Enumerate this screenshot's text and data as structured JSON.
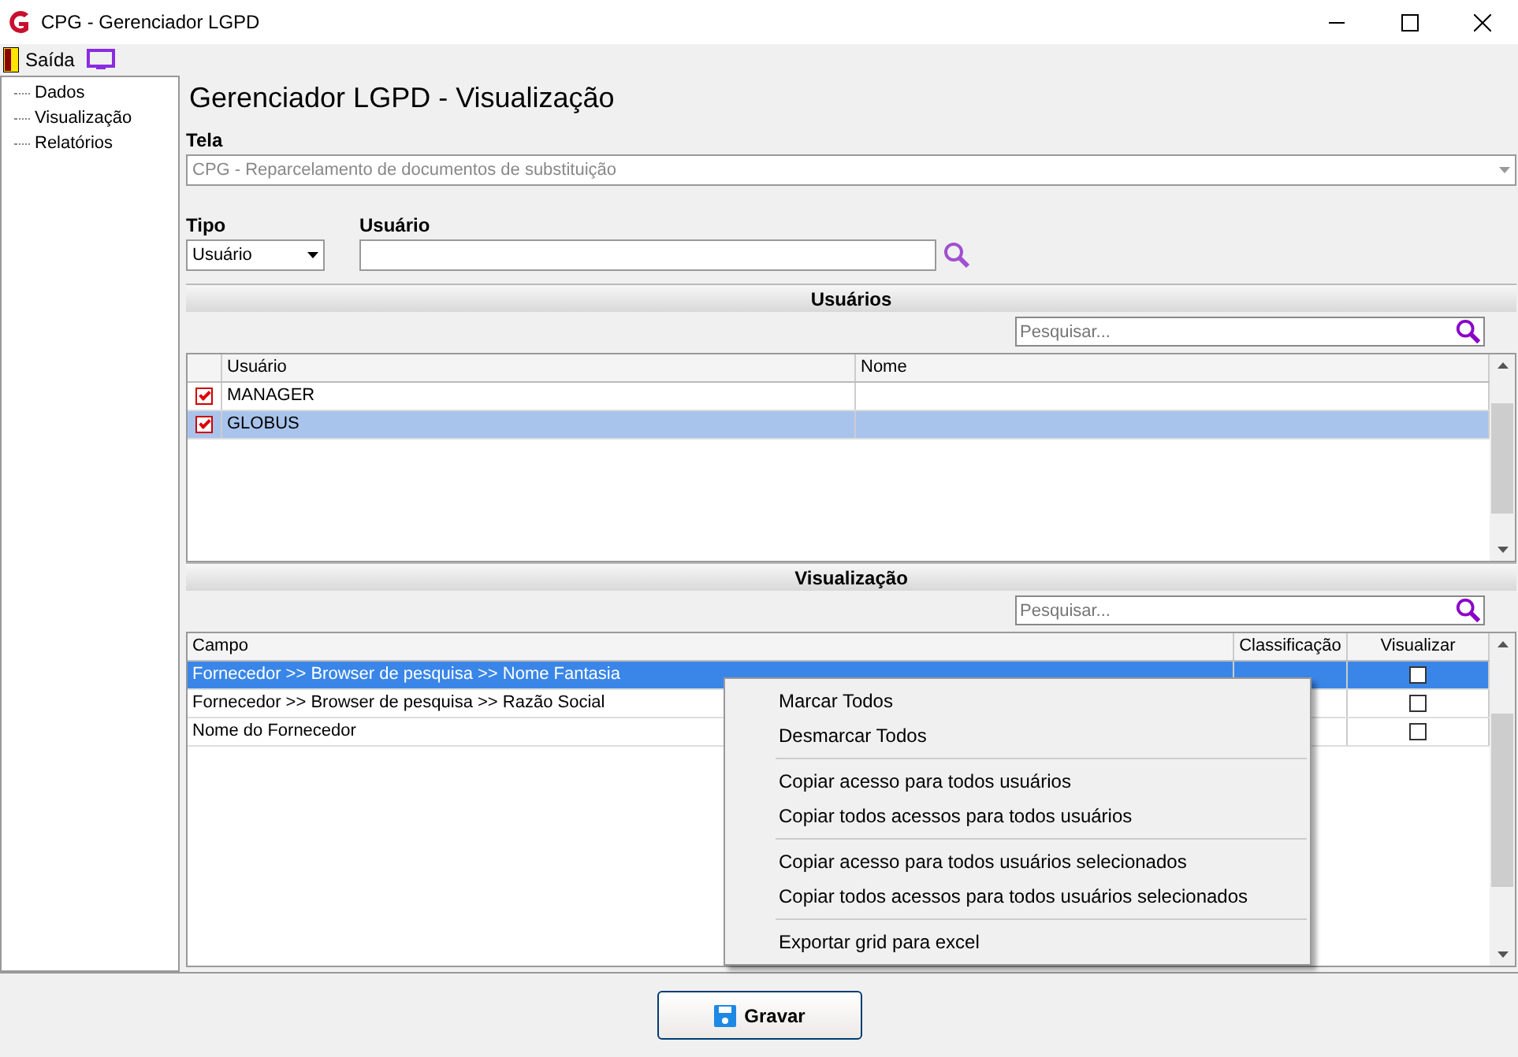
{
  "window": {
    "title": "CPG - Gerenciador LGPD"
  },
  "toolbar": {
    "exit_label": "Saída"
  },
  "sidebar": {
    "items": [
      {
        "label": "Dados",
        "selected": false
      },
      {
        "label": "Visualização",
        "selected": false
      },
      {
        "label": "Relatórios",
        "selected": false
      }
    ]
  },
  "page": {
    "heading": "Gerenciador LGPD - Visualização",
    "tela": {
      "label": "Tela",
      "value": "CPG - Reparcelamento de documentos de substituição",
      "disabled": true
    },
    "tipo": {
      "label": "Tipo",
      "value": "Usuário"
    },
    "usuario": {
      "label": "Usuário"
    }
  },
  "users": {
    "title": "Usuários",
    "search_placeholder": "Pesquisar...",
    "columns": [
      "Usuário",
      "Nome"
    ],
    "rows": [
      {
        "usuario": "MANAGER",
        "checked": true,
        "selected": false
      },
      {
        "usuario": "GLOBUS",
        "checked": true,
        "selected": true
      }
    ]
  },
  "views": {
    "title": "Visualização",
    "search_placeholder": "Pesquisar...",
    "columns": [
      "Campo",
      "Classificação",
      "Visualizar"
    ],
    "rows": [
      {
        "campo": "Fornecedor >> Browser de pesquisa >> Nome Fantasia",
        "checked": false,
        "selected": true
      },
      {
        "campo": "Fornecedor >> Browser de pesquisa >> Razão Social",
        "checked": false,
        "selected": false
      },
      {
        "campo": "Nome do Fornecedor",
        "checked": false,
        "selected": false
      }
    ]
  },
  "context_menu": {
    "groups": [
      [
        "Marcar Todos",
        "Desmarcar Todos"
      ],
      [
        "Copiar acesso para todos usuários",
        "Copiar todos acessos para todos usuários"
      ],
      [
        "Copiar acesso para todos usuários selecionados",
        "Copiar todos acessos para todos usuários selecionados"
      ],
      [
        "Exportar grid para excel"
      ]
    ]
  },
  "footer": {
    "save_label": "Gravar"
  }
}
